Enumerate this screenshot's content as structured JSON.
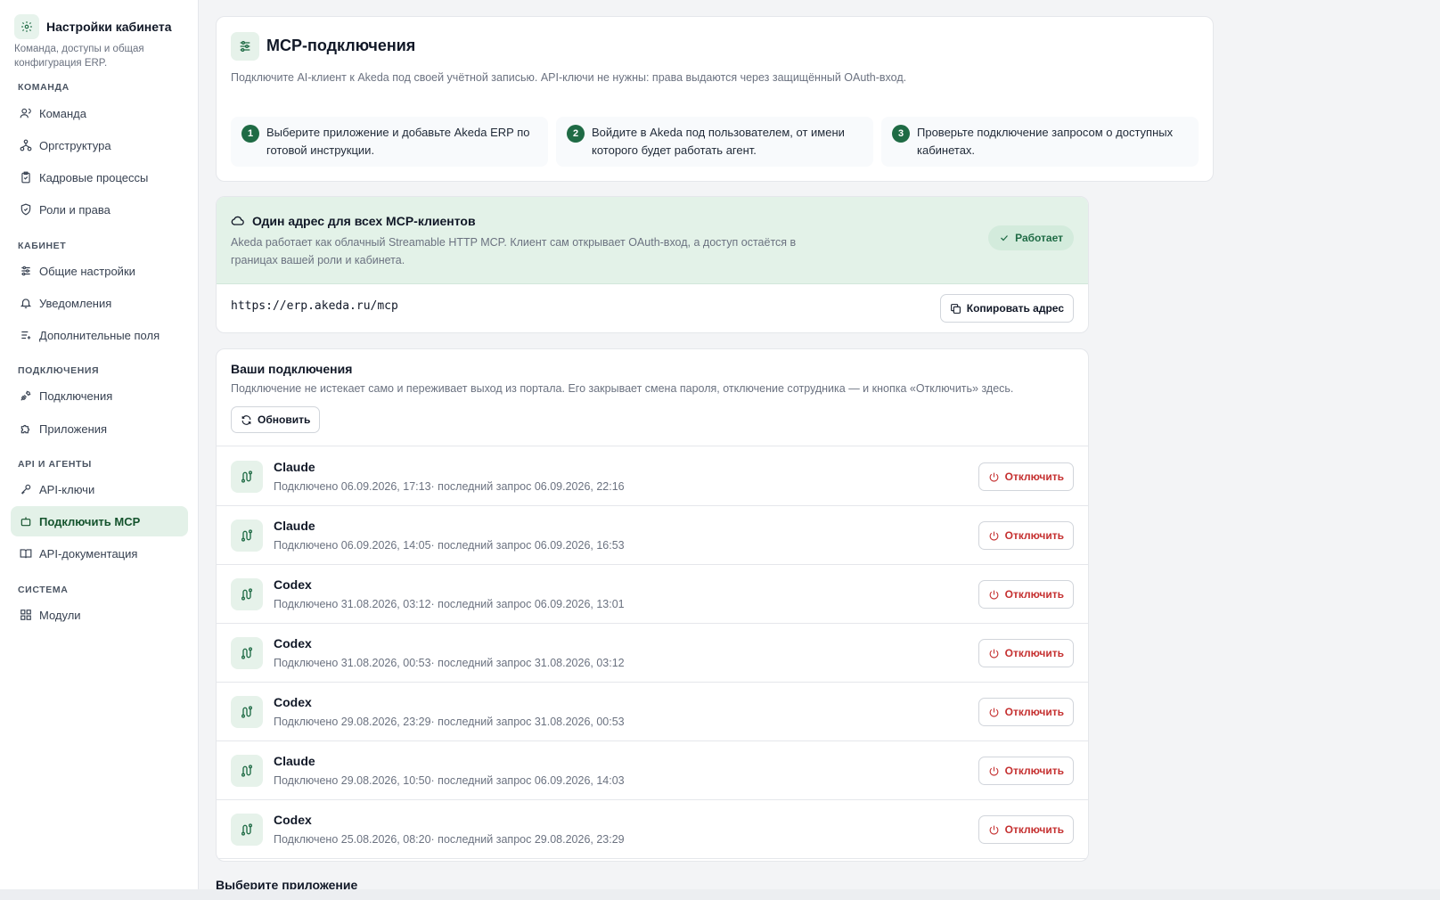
{
  "sidebar": {
    "title": "Настройки кабинета",
    "subtitle": "Команда, доступы и общая конфигурация ERP.",
    "sections": {
      "team": "Команда",
      "cabinet": "Кабинет",
      "connections": "Подключения",
      "api": "API и агенты",
      "system": "Система"
    },
    "items": {
      "team": "Команда",
      "orgstructure": "Оргструктура",
      "hr": "Кадровые процессы",
      "roles": "Роли и права",
      "general": "Общие настройки",
      "notifications": "Уведомления",
      "fields": "Дополнительные поля",
      "connections": "Подключения",
      "apps": "Приложения",
      "api_keys": "API-ключи",
      "mcp": "Подключить MCP",
      "api_docs": "API-документация",
      "modules": "Модули"
    }
  },
  "hero": {
    "title": "MCP-подключения",
    "description": "Подключите AI-клиент к Akeda под своей учётной записью. API-ключи не нужны: права выдаются через защищённый OAuth-вход.",
    "steps": [
      {
        "num": "1",
        "text": "Выберите приложение и добавьте Akeda ERP по готовой инструкции."
      },
      {
        "num": "2",
        "text": "Войдите в Akeda под пользователем, от имени которого будет работать агент."
      },
      {
        "num": "3",
        "text": "Проверьте подключение запросом о доступных кабинетах."
      }
    ]
  },
  "address": {
    "title": "Один адрес для всех MCP-клиентов",
    "description": "Akeda работает как облачный Streamable HTTP MCP. Клиент сам открывает OAuth-вход, а доступ остаётся в границах вашей роли и кабинета.",
    "status": "Работает",
    "url": "https://erp.akeda.ru/mcp",
    "copy_label": "Копировать адрес"
  },
  "connections": {
    "title": "Ваши подключения",
    "description": "Подключение не истекает само и переживает выход из портала. Его закрывает смена пароля, отключение сотрудника — и кнопка «Отключить» здесь.",
    "refresh_label": "Обновить",
    "disconnect_label": "Отключить",
    "rows": [
      {
        "name": "Claude",
        "meta": "Подключено 06.09.2026, 17:13· последний запрос 06.09.2026, 22:16"
      },
      {
        "name": "Claude",
        "meta": "Подключено 06.09.2026, 14:05· последний запрос 06.09.2026, 16:53"
      },
      {
        "name": "Codex",
        "meta": "Подключено 31.08.2026, 03:12· последний запрос 06.09.2026, 13:01"
      },
      {
        "name": "Codex",
        "meta": "Подключено 31.08.2026, 00:53· последний запрос 31.08.2026, 03:12"
      },
      {
        "name": "Codex",
        "meta": "Подключено 29.08.2026, 23:29· последний запрос 31.08.2026, 00:53"
      },
      {
        "name": "Claude",
        "meta": "Подключено 29.08.2026, 10:50· последний запрос 06.09.2026, 14:03"
      },
      {
        "name": "Codex",
        "meta": "Подключено 25.08.2026, 08:20· последний запрос 29.08.2026, 23:29"
      }
    ]
  },
  "choose_app": "Выберите приложение",
  "colors": {
    "accent": "#1f6b45",
    "accent_light": "#e3f2e8",
    "danger": "#c53030"
  }
}
